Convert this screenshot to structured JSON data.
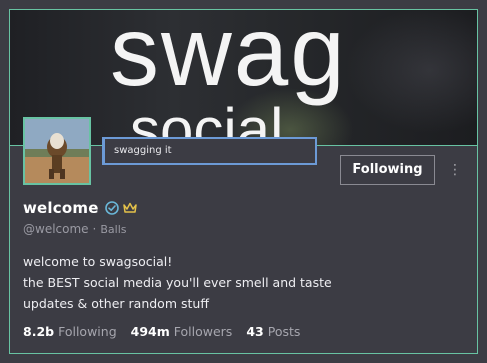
{
  "banner": {
    "big_text": "swag",
    "small_text": "social"
  },
  "tooltip": {
    "text": "swagging it"
  },
  "profile": {
    "display_name": "welcome",
    "handle": "@welcome",
    "separator": "·",
    "handle_extra": "Balls",
    "verified_icon": "verified-check-icon",
    "crown_icon": "crown-icon"
  },
  "actions": {
    "follow_label": "Following",
    "more_label": "⋮"
  },
  "bio": {
    "lines": [
      "welcome to swagsocial!",
      "the BEST social media you'll ever smell and taste",
      "updates & other random stuff"
    ]
  },
  "stats": [
    {
      "value": "8.2b",
      "label": "Following"
    },
    {
      "value": "494m",
      "label": "Followers"
    },
    {
      "value": "43",
      "label": "Posts"
    }
  ],
  "colors": {
    "accent": "#68c3a3",
    "tooltip_border": "#6c9ad6",
    "background": "#3c3c44",
    "verified": "#6ab7d8",
    "crown": "#e3c14a"
  }
}
